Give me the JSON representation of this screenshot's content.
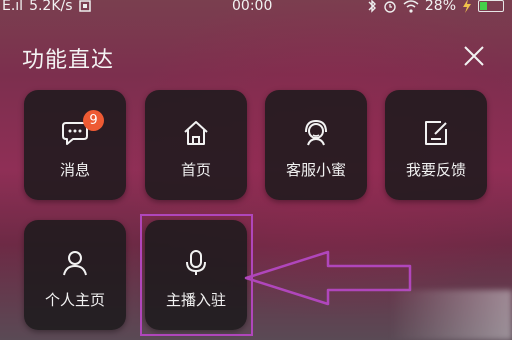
{
  "status_bar": {
    "signal": "E.ıl",
    "speed": "5.2K/s",
    "clock": "00:00",
    "battery_percent": "28%",
    "battery_level": 0.28,
    "battery_color": "#45d04a"
  },
  "panel": {
    "title": "功能直达"
  },
  "tiles": [
    {
      "label": "消息",
      "icon": "chat-bubble-icon",
      "badge": "9"
    },
    {
      "label": "首页",
      "icon": "home-icon"
    },
    {
      "label": "客服小蜜",
      "icon": "customer-service-icon"
    },
    {
      "label": "我要反馈",
      "icon": "feedback-edit-icon"
    },
    {
      "label": "个人主页",
      "icon": "person-icon"
    },
    {
      "label": "主播入驻",
      "icon": "microphone-icon"
    }
  ],
  "annotation": {
    "highlight_color": "#b046bb"
  }
}
